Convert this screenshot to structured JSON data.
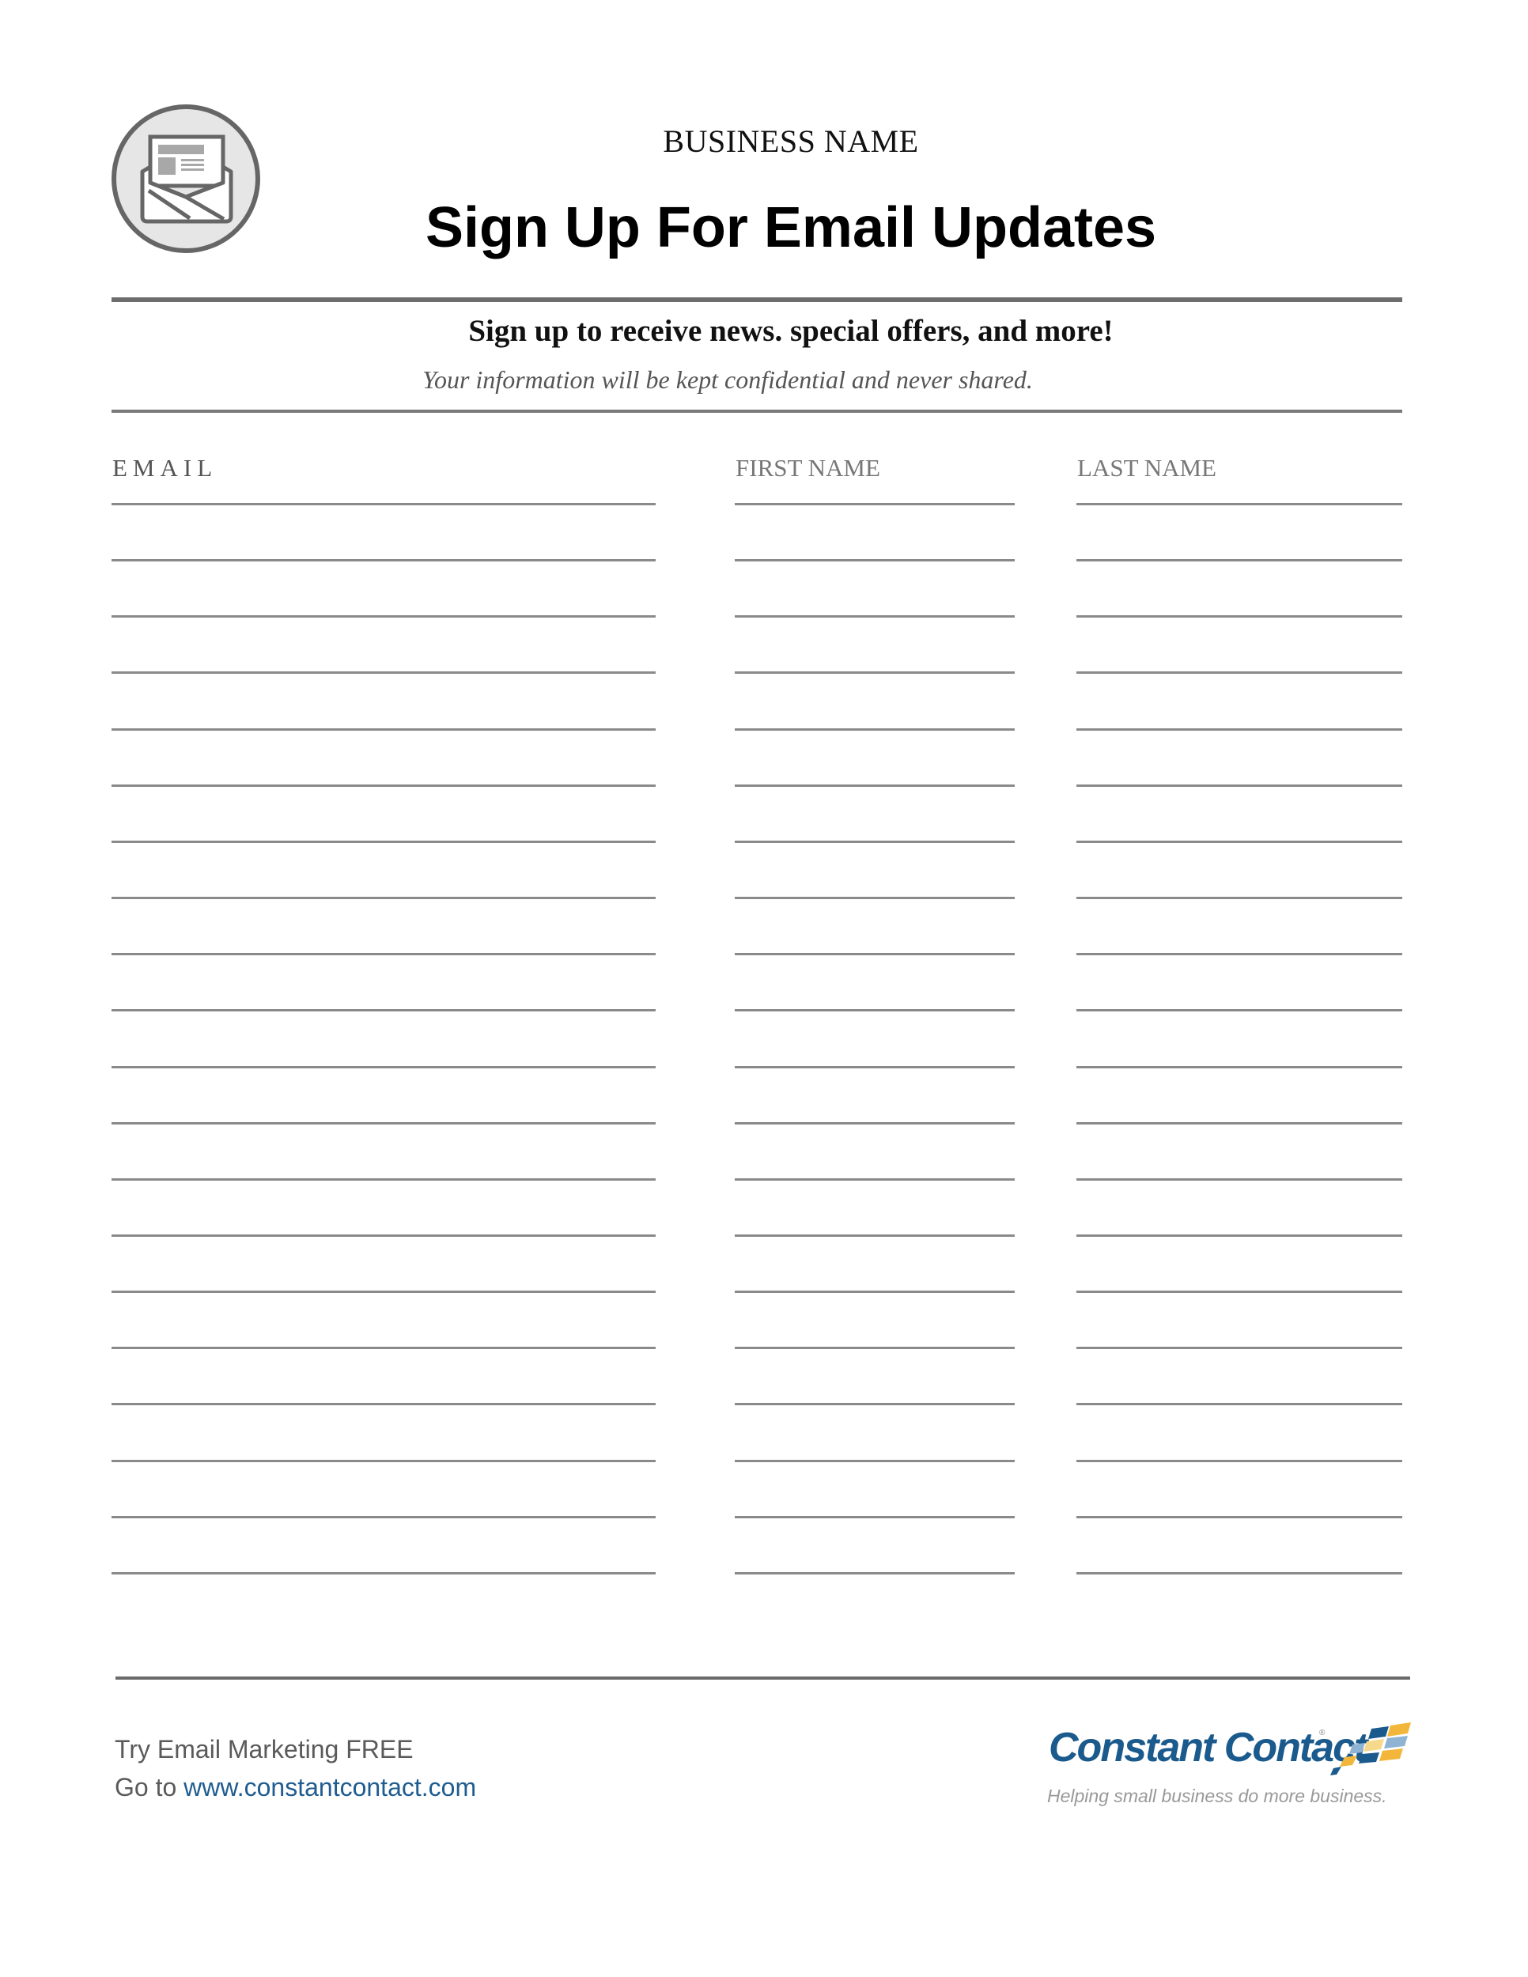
{
  "header": {
    "icon": "newsletter-envelope-icon",
    "business_name": "BUSINESS NAME",
    "title": "Sign Up For Email Updates"
  },
  "intro": {
    "tagline": "Sign up to receive news. special offers, and more!",
    "privacy_note": "Your information will be kept confidential and never shared."
  },
  "form": {
    "columns": [
      {
        "key": "email",
        "label": "EMAIL"
      },
      {
        "key": "first",
        "label": "FIRST NAME"
      },
      {
        "key": "last",
        "label": "LAST NAME"
      }
    ],
    "row_count": 20
  },
  "footer": {
    "promo_line": "Try Email Marketing FREE",
    "goto_prefix": "Go to ",
    "link": "www.constantcontact.com",
    "brand": {
      "name": "Constant Contact",
      "registered_mark": "®",
      "tagline": "Helping small business do more business.",
      "icon": "constant-contact-mark-icon",
      "colors": {
        "blue": "#1b5a8c",
        "yellow": "#f2b63a",
        "light_blue": "#8fb3d3"
      }
    }
  }
}
